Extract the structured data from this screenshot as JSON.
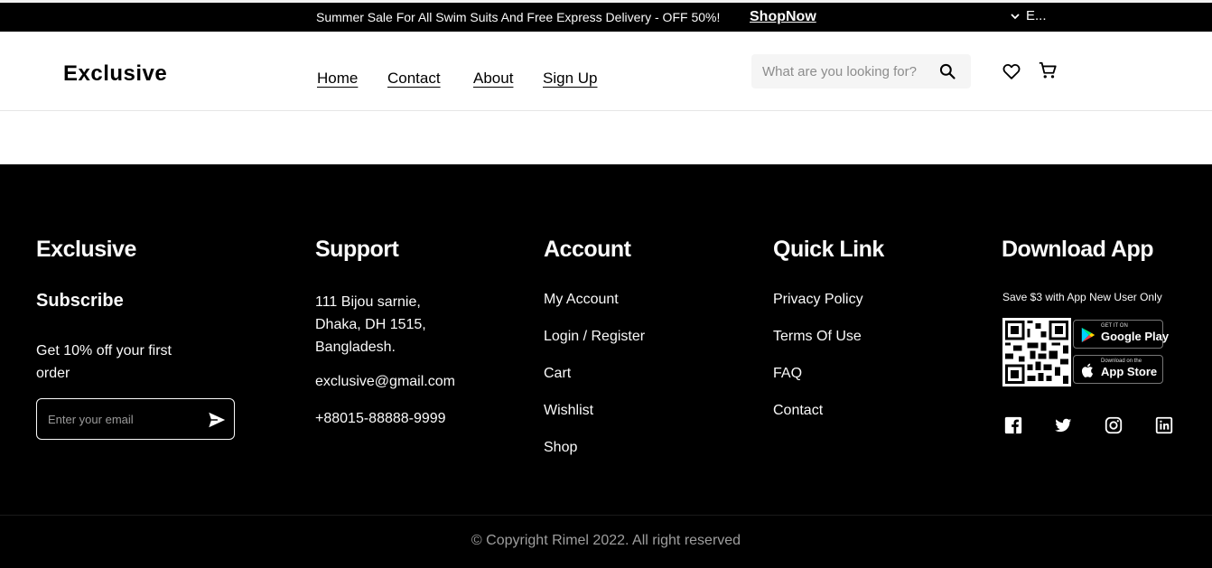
{
  "banner": {
    "text": "Summer Sale For All Swim Suits And Free Express Delivery - OFF 50%!",
    "link": "ShopNow",
    "language": "E..."
  },
  "header": {
    "logo": "Exclusive",
    "nav": [
      "Home",
      "Contact",
      "About",
      "Sign Up"
    ],
    "search_placeholder": "What are you looking for?"
  },
  "footer": {
    "brand": {
      "title": "Exclusive",
      "subtitle": "Subscribe",
      "offer": "Get 10% off your first order",
      "email_placeholder": "Enter your email"
    },
    "support": {
      "title": "Support",
      "address": [
        "111 Bijou sarnie,",
        "Dhaka, DH 1515,",
        "Bangladesh."
      ],
      "email": "exclusive@gmail.com",
      "phone": "+88015-88888-9999"
    },
    "account": {
      "title": "Account",
      "links": [
        "My Account",
        "Login / Register",
        "Cart",
        "Wishlist",
        "Shop"
      ]
    },
    "quick_link": {
      "title": "Quick Link",
      "links": [
        "Privacy Policy",
        "Terms Of Use",
        "FAQ",
        "Contact"
      ]
    },
    "download": {
      "title": "Download App",
      "save_text": "Save $3 with App New User Only",
      "google_play": {
        "small": "GET IT ON",
        "big": "Google Play"
      },
      "app_store": {
        "small": "Download on the",
        "big": "App Store"
      },
      "social_icons": [
        "facebook-icon",
        "twitter-icon",
        "instagram-icon",
        "linkedin-icon"
      ]
    },
    "copyright": "© Copyright Rimel 2022. All right reserved"
  },
  "colors": {
    "banner_bg": "#000000",
    "footer_bg": "#000000",
    "text_light": "#FAFAFA",
    "search_bg": "#F5F5F5",
    "copyright_text": "#9E9E9E"
  }
}
